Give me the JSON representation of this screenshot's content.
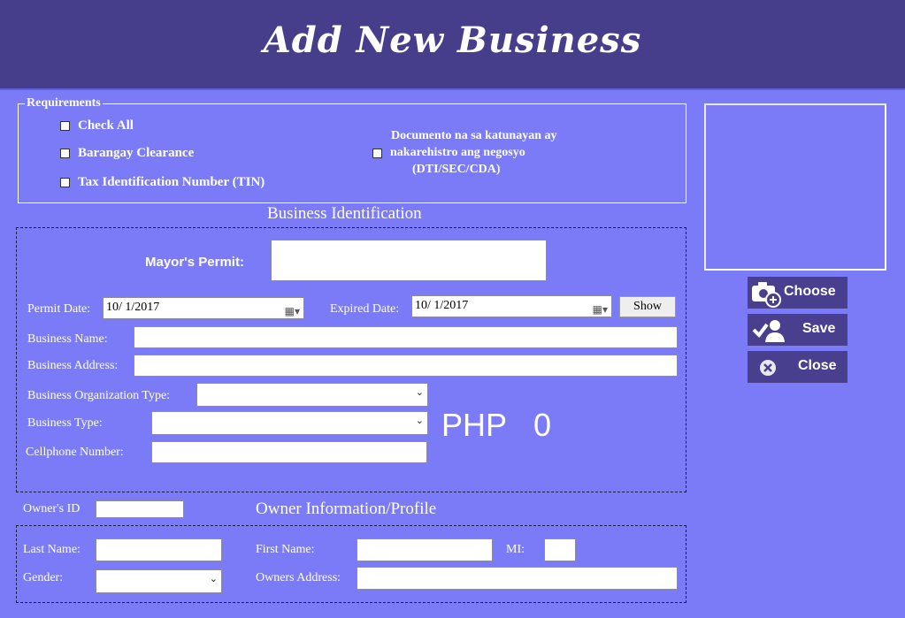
{
  "header": {
    "title": "Add New Business"
  },
  "requirements": {
    "legend": "Requirements",
    "items": [
      {
        "label": "Check All"
      },
      {
        "label": "Barangay Clearance"
      },
      {
        "label": "Tax Identification Number (TIN)"
      }
    ],
    "dti_line1": "Documento na sa katunayan ay",
    "dti_line2": "nakarehistro ang negosyo",
    "dti_line3": "(DTI/SEC/CDA)"
  },
  "business": {
    "section_title": "Business Identification",
    "mayors_permit_label": "Mayor's Permit:",
    "permit_date_label": "Permit Date:",
    "permit_date_value": "10/  1/2017",
    "expired_date_label": "Expired Date:",
    "expired_date_value": "10/  1/2017",
    "show_button": "Show",
    "name_label": "Business Name:",
    "address_label": "Business Address:",
    "org_type_label": "Business Organization Type:",
    "type_label": "Business Type:",
    "cellphone_label": "Cellphone Number:",
    "php_currency": "PHP",
    "php_amount": "0"
  },
  "owner": {
    "id_label": "Owner's ID",
    "section_title": "Owner Information/Profile",
    "last_name_label": "Last Name:",
    "first_name_label": "First Name:",
    "mi_label": "MI:",
    "gender_label": "Gender:",
    "address_label": "Owners Address:"
  },
  "side_buttons": {
    "choose": "Choose",
    "save": "Save",
    "close": "Close"
  },
  "colors": {
    "background": "#7b7bf7",
    "header": "#473e8b",
    "button": "#483f8e"
  }
}
